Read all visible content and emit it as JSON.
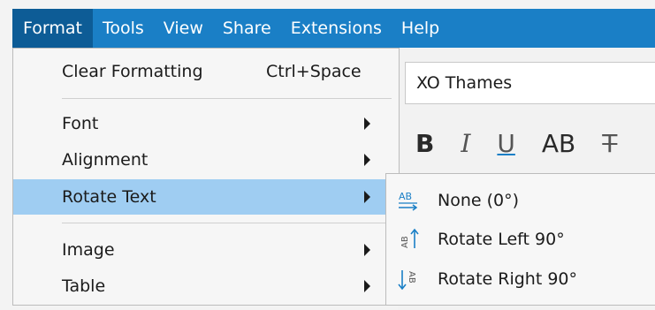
{
  "menubar": {
    "items": [
      "Format",
      "Tools",
      "View",
      "Share",
      "Extensions",
      "Help"
    ]
  },
  "editor": {
    "font_name": "XO Thames",
    "format_buttons": [
      "B",
      "I",
      "U",
      "AB",
      "T"
    ]
  },
  "format_menu": {
    "clear_formatting": {
      "label": "Clear Formatting",
      "shortcut": "Ctrl+Space"
    },
    "font": {
      "label": "Font"
    },
    "alignment": {
      "label": "Alignment"
    },
    "rotate_text": {
      "label": "Rotate Text"
    },
    "image": {
      "label": "Image"
    },
    "table": {
      "label": "Table"
    }
  },
  "rotate_submenu": {
    "items": [
      {
        "label": "None (0°)",
        "icon": "text-none-icon",
        "icon_text": "AB"
      },
      {
        "label": "Rotate Left 90°",
        "icon": "rotate-left-icon",
        "icon_text": "AB"
      },
      {
        "label": "Rotate Right 90°",
        "icon": "rotate-right-icon",
        "icon_text": "AB"
      }
    ]
  },
  "colors": {
    "menubar": "#1a7fc6",
    "menubar_active": "#0d5c96",
    "highlight": "#9fcdf2",
    "icon_blue": "#1a7fc6"
  }
}
